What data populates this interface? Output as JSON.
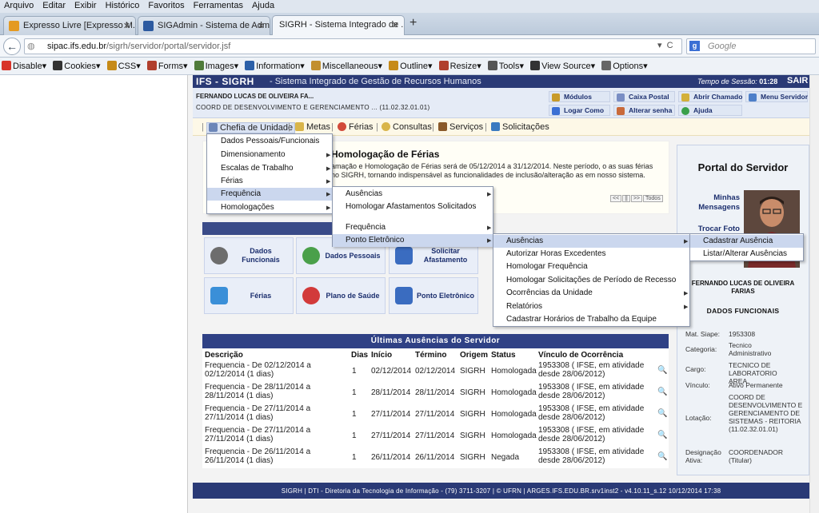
{
  "browser": {
    "menu": [
      "Arquivo",
      "Editar",
      "Exibir",
      "Histórico",
      "Favoritos",
      "Ferramentas",
      "Ajuda"
    ],
    "tabs": [
      {
        "label": "Expresso Livre [Expresso M...",
        "color": "#e49a22"
      },
      {
        "label": "SIGAdmin - Sistema de Admini...",
        "color": "#2c5aa0"
      },
      {
        "label": "SIGRH - Sistema Integrado de ...",
        "color": "#2c5aa0"
      }
    ],
    "new_tab": "+",
    "url_host": "sipac.ifs.edu.br",
    "url_path": "/sigrh/servidor/portal/servidor.jsf",
    "search_placeholder": "Google",
    "devbar": [
      {
        "label": "Disable▾",
        "color": "#d8342a"
      },
      {
        "label": "Cookies▾",
        "color": "#333"
      },
      {
        "label": "CSS▾",
        "color": "#c68a18"
      },
      {
        "label": "Forms▾",
        "color": "#b03f2d"
      },
      {
        "label": "Images▾",
        "color": "#4f7b3a"
      },
      {
        "label": "Information▾",
        "color": "#2b5fa8"
      },
      {
        "label": "Miscellaneous▾",
        "color": "#c28f2f"
      },
      {
        "label": "Outline▾",
        "color": "#c68a18"
      },
      {
        "label": "Resize▾",
        "color": "#b03f2d"
      },
      {
        "label": "Tools▾",
        "color": "#555"
      },
      {
        "label": "View Source▾",
        "color": "#333"
      },
      {
        "label": "Options▾",
        "color": "#666"
      }
    ]
  },
  "header": {
    "brand": "IFS - SIGRH",
    "subtitle": "- Sistema Integrado de Gestão de Recursos Humanos",
    "session_label": "Tempo de Sessão:",
    "session_time": "01:28",
    "logout": "SAIR",
    "user_name": "FERNANDO LUCAS DE OLIVEIRA FA...",
    "user_unit": "COORD DE DESENVOLVIMENTO E GERENCIAMENTO ... (11.02.32.01.01)",
    "quick": [
      "Módulos",
      "Caixa Postal",
      "Abrir Chamado",
      "Menu Servidor",
      "Logar Como",
      "Alterar senha",
      "Ajuda"
    ]
  },
  "main_menu": [
    "Chefia de Unidade",
    "Metas",
    "Férias",
    "Consultas",
    "Serviços",
    "Solicitações"
  ],
  "info": {
    "title": "Homologação de Férias",
    "text": "amação e Homologação de Férias será de 05/12/2014 a 31/12/2014. Neste período, o as suas férias no SIGRH, tornando indispensável as funcionalidades de inclusão/alteração as em nosso sistema.",
    "pager": [
      "<<",
      "||",
      ">>",
      "Todos"
    ]
  },
  "services": [
    {
      "label": "Dados Funcionais",
      "color": "#6d6d6d"
    },
    {
      "label": "Dados Pessoais",
      "color": "#4aa04a"
    },
    {
      "label": "Solicitar Afastamento",
      "color": "#3a6cc0"
    },
    {
      "label": "Férias",
      "color": "#3a8fd8"
    },
    {
      "label": "Plano de Saúde",
      "color": "#d23a3a"
    },
    {
      "label": "Ponto Eletrônico",
      "color": "#3a6cc0"
    }
  ],
  "dropdown1": [
    "Dados Pessoais/Funcionais",
    "Dimensionamento",
    "Escalas de Trabalho",
    "Férias",
    "Frequência",
    "Homologações"
  ],
  "dropdown2": [
    "Ausências",
    "Homologar Afastamentos Solicitados",
    "Frequência",
    "Ponto Eletrônico"
  ],
  "dropdown3": [
    "Ausências",
    "Autorizar Horas Excedentes",
    "Homologar Frequência",
    "Homologar Solicitações de Período de Recesso",
    "Ocorrências da Unidade",
    "Relatórios",
    "Cadastrar Horários de Trabalho da Equipe"
  ],
  "dropdown4": [
    "Cadastrar Ausência",
    "Listar/Alterar Ausências"
  ],
  "absences": {
    "title": "Últimas Ausências do Servidor",
    "headers": [
      "Descrição",
      "Dias",
      "Início",
      "Término",
      "Origem",
      "Status",
      "Vínculo de Ocorrência"
    ],
    "rows": [
      {
        "desc1": "Frequencia - De 02/12/2014 a",
        "desc2": "02/12/2014 (1 dias)",
        "dias": "1",
        "inicio": "02/12/2014",
        "termino": "02/12/2014",
        "origem": "SIGRH",
        "status": "Homologada",
        "v1": "1953308 ( IFSE, em atividade",
        "v2": "desde 28/06/2012)"
      },
      {
        "desc1": "Frequencia - De 28/11/2014 a",
        "desc2": "28/11/2014 (1 dias)",
        "dias": "1",
        "inicio": "28/11/2014",
        "termino": "28/11/2014",
        "origem": "SIGRH",
        "status": "Homologada",
        "v1": "1953308 ( IFSE, em atividade",
        "v2": "desde 28/06/2012)"
      },
      {
        "desc1": "Frequencia - De 27/11/2014 a",
        "desc2": "27/11/2014 (1 dias)",
        "dias": "1",
        "inicio": "27/11/2014",
        "termino": "27/11/2014",
        "origem": "SIGRH",
        "status": "Homologada",
        "v1": "1953308 ( IFSE, em atividade",
        "v2": "desde 28/06/2012)"
      },
      {
        "desc1": "Frequencia - De 27/11/2014 a",
        "desc2": "27/11/2014 (1 dias)",
        "dias": "1",
        "inicio": "27/11/2014",
        "termino": "27/11/2014",
        "origem": "SIGRH",
        "status": "Homologada",
        "v1": "1953308 ( IFSE, em atividade",
        "v2": "desde 28/06/2012)"
      },
      {
        "desc1": "Frequencia - De 26/11/2014 a",
        "desc2": "26/11/2014 (1 dias)",
        "dias": "1",
        "inicio": "26/11/2014",
        "termino": "26/11/2014",
        "origem": "SIGRH",
        "status": "Negada",
        "v1": "1953308 ( IFSE, em atividade",
        "v2": "desde 28/06/2012)"
      }
    ]
  },
  "portal": {
    "title": "Portal do Servidor",
    "link_messages": "Minhas Mensagens",
    "link_photo": "Trocar Foto",
    "name": "FERNANDO LUCAS DE OLIVEIRA FARIAS",
    "section": "DADOS FUNCIONAIS",
    "fields": [
      {
        "label": "Mat. Siape:",
        "value": "1953308"
      },
      {
        "label": "Categoria:",
        "value": "Tecnico Administrativo"
      },
      {
        "label": "Cargo:",
        "value": "TECNICO DE LABORATORIO AREA"
      },
      {
        "label": "Vínculo:",
        "value": "Ativo Permanente"
      },
      {
        "label": "Lotação:",
        "value": "COORD DE DESENVOLVIMENTO E GERENCIAMENTO DE SISTEMAS - REITORIA (11.02.32.01.01)"
      },
      {
        "label": "Designação Ativa:",
        "value": "COORDENADOR (Titular)"
      }
    ]
  },
  "footer": "SIGRH | DTI - Diretoria da Tecnologia de Informação - (79) 3711-3207 | © UFRN | ARGES.IFS.EDU.BR.srv1inst2 - v4.10.11_s.12 10/12/2014 17:38"
}
